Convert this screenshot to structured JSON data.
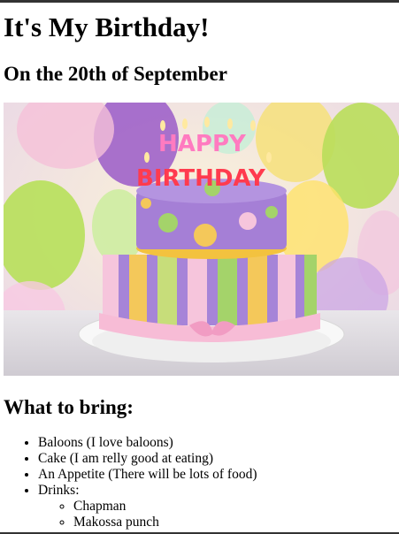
{
  "page": {
    "title": "It's My Birthday!",
    "subtitle": "On the 20th of September",
    "section_heading": "What to bring:",
    "hero_image": {
      "alt": "Birthday cake",
      "cake_topper_line1": "HAPPY",
      "cake_topper_line2": "BIRTHDAY"
    },
    "bring_list": [
      "Baloons (I love baloons)",
      "Cake (I am relly good at eating)",
      "An Appetite (There will be lots of food)",
      "Drinks:"
    ],
    "drinks": [
      "Chapman",
      "Makossa punch"
    ]
  }
}
